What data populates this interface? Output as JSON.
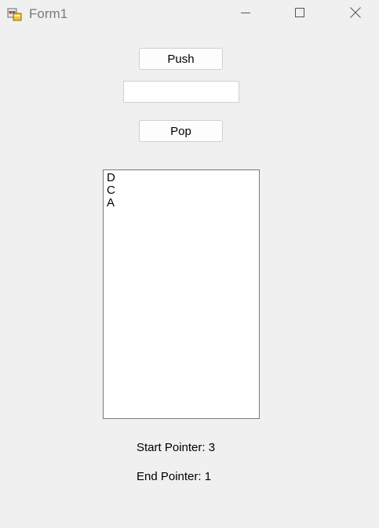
{
  "window": {
    "title": "Form1"
  },
  "buttons": {
    "push_label": "Push",
    "pop_label": "Pop"
  },
  "input": {
    "value": "",
    "placeholder": ""
  },
  "stack_list": {
    "items": [
      "D",
      "C",
      "A"
    ]
  },
  "pointers": {
    "start_label": "Start Pointer: 3",
    "end_label": "End Pointer: 1"
  }
}
